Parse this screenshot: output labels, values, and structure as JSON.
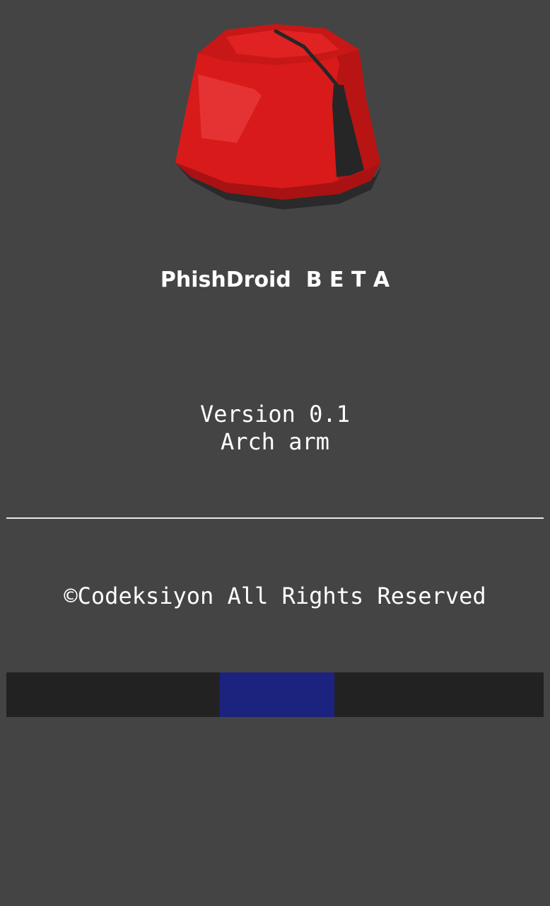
{
  "app": {
    "name": "PhishDroid",
    "edition": "B E T A",
    "title_full": "PhishDroid  B E T A"
  },
  "logo": {
    "icon": "fez-hat-icon",
    "colors": {
      "hat_red": "#d81a1a",
      "hat_dark_red": "#a81212",
      "hat_band": "#2a2a2a",
      "tassel": "#262626"
    }
  },
  "version": {
    "version_line": "Version 0.1",
    "arch_line": "Arch arm"
  },
  "footer": {
    "copyright": "©Codeksiyon All Rights Reserved"
  },
  "loading_bar": {
    "track_color": "#222222",
    "indicator_color": "#1c237e",
    "indicator_start_fraction": 0.397,
    "indicator_end_fraction": 0.61
  },
  "theme": {
    "background": "#444444",
    "text": "#ffffff",
    "divider": "#e8e8e8"
  }
}
